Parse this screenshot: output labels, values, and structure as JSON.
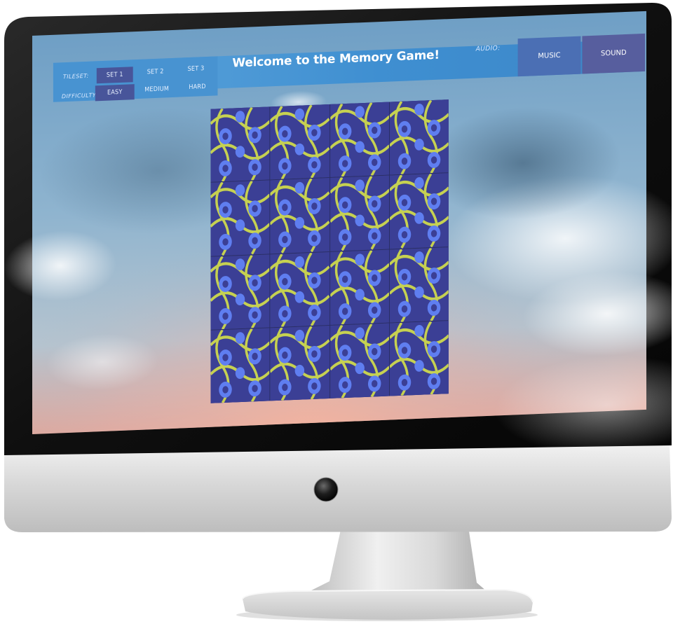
{
  "topbar": {
    "tileset_label": "TILESET:",
    "difficulty_label": "DIFFICULTY:",
    "tilesets": [
      "SET 1",
      "SET 2",
      "SET 3"
    ],
    "difficulties": [
      "EASY",
      "MEDIUM",
      "HARD"
    ],
    "title": "Welcome to the Memory Game!",
    "audio_label": "AUDIO:",
    "music_label": "MUSIC",
    "sound_label": "SOUND"
  },
  "board": {
    "rows": 4,
    "columns": 4,
    "tile_state": "face-down"
  },
  "colors": {
    "tile_back": "#3b3f95",
    "tile_pattern": "#5f7ef0",
    "tile_accent": "#d6e14a",
    "active_button": "#48559a",
    "audio_music": "#4b6fb4",
    "audio_sound": "#575e9e"
  },
  "icons": {
    "power_button": "power-button-icon"
  }
}
